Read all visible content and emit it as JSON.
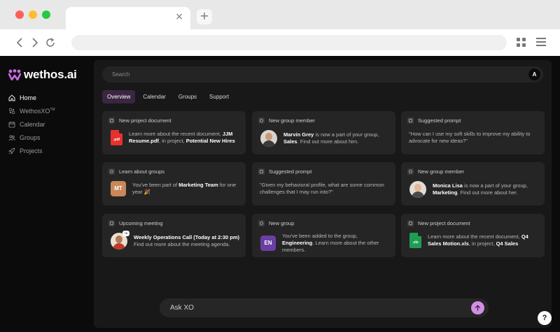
{
  "browser": {
    "new_tab_symbol": "+",
    "tab_close_symbol": "×"
  },
  "brand": {
    "name": "wethos.ai",
    "accent": "#c86be0"
  },
  "sidebar": {
    "items": [
      {
        "label": "Home",
        "icon": "home-icon",
        "active": true
      },
      {
        "label": "WethosXO",
        "sup": "TM",
        "icon": "xo-icon"
      },
      {
        "label": "Calendar",
        "icon": "calendar-icon"
      },
      {
        "label": "Groups",
        "icon": "groups-icon"
      },
      {
        "label": "Projects",
        "icon": "projects-icon"
      }
    ]
  },
  "search": {
    "placeholder": "Search",
    "avatar_initial": "A"
  },
  "tabs": [
    {
      "label": "Overview",
      "active": true
    },
    {
      "label": "Calendar"
    },
    {
      "label": "Groups"
    },
    {
      "label": "Support"
    }
  ],
  "cards": [
    {
      "title": "New project document",
      "pre": "Learn more about the recent document, ",
      "bold1": "JJM Resume.pdf",
      "mid": ", in project, ",
      "bold2": "Potential New Hires",
      "post": "",
      "thumb": "pdf-file-icon",
      "thumb_label": ".pdf",
      "thumb_color": "#e5322d"
    },
    {
      "title": "New group member",
      "pre": "",
      "bold1": "Marvin Grey",
      "mid": " is now a part of your group, ",
      "bold2": "Sales",
      "post": ". Find out more about him.",
      "thumb": "avatar-marvin"
    },
    {
      "title": "Suggested prompt",
      "quote": "\"How can I use my soft skills to improve my ability to advocate for new ideas?\""
    },
    {
      "title": "Learn about groups",
      "pre": "You've been part of ",
      "bold1": "Marketing Team",
      "mid": " for one year 🎉",
      "bold2": "",
      "post": "",
      "thumb": "group-mt",
      "thumb_label": "MT",
      "thumb_color": "#c9875a"
    },
    {
      "title": "Suggested prompt",
      "quote": "\"Given my behavioral profile, what are some common challenges that I may run into?\""
    },
    {
      "title": "New group member",
      "pre": "",
      "bold1": "Monica Lisa",
      "mid": " is now a part of your group, ",
      "bold2": "Marketing",
      "post": ". Find out more about her.",
      "thumb": "avatar-monica"
    },
    {
      "title": "Upcoming meeting",
      "pre": "",
      "bold1": "Weekly Operations Call (Today at 2:30 pm)",
      "mid": " Find out more about the meeting agenda.",
      "bold2": "",
      "post": "",
      "thumb": "avatar-meeting",
      "badge": "+6"
    },
    {
      "title": "New group",
      "pre": "You've been added to the group, ",
      "bold1": "Engineering",
      "mid": ". Learn more about the other members.",
      "bold2": "",
      "post": "",
      "thumb": "group-en",
      "thumb_label": "EN",
      "thumb_color": "#6b3fa3"
    },
    {
      "title": "New project document",
      "pre": "Learn more about the recent document, ",
      "bold1": "Q4 Sales Motion.xls",
      "mid": ", in project, ",
      "bold2": "Q4 Sales",
      "post": "",
      "thumb": "xls-file-icon",
      "thumb_label": ".xls",
      "thumb_color": "#1f9d55"
    }
  ],
  "ask": {
    "placeholder": "Ask XO"
  },
  "help": {
    "label": "?"
  }
}
